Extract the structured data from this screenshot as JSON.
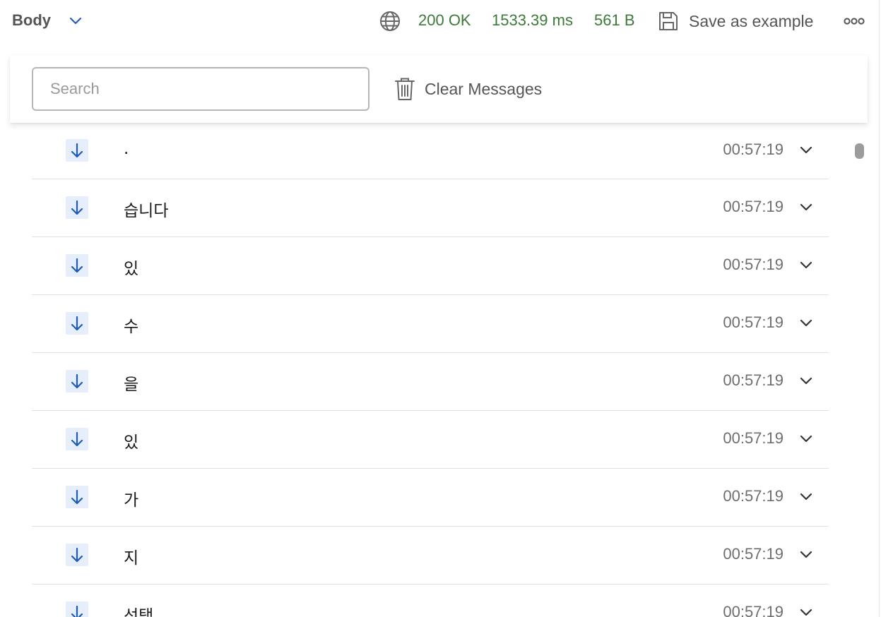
{
  "topbar": {
    "body_label": "Body",
    "status_code": "200 OK",
    "response_time": "1533.39 ms",
    "response_size": "561 B",
    "save_label": "Save as example",
    "icons": {
      "body_dropdown": "chevron-down-icon",
      "network": "globe-icon",
      "save": "save-icon",
      "more": "more-options-icon"
    }
  },
  "search": {
    "placeholder": "Search",
    "value": ""
  },
  "clear_messages": {
    "label": "Clear Messages",
    "icon": "trash-icon"
  },
  "colors": {
    "status_green": "#3d7a3a",
    "arrow_blue": "#1f5bb8",
    "arrow_bg": "#e6eefb",
    "text_gray": "#555555"
  },
  "messages": [
    {
      "direction": "received",
      "text": ".",
      "time": "00:57:19"
    },
    {
      "direction": "received",
      "text": "습니다",
      "time": "00:57:19"
    },
    {
      "direction": "received",
      "text": "있",
      "time": "00:57:19"
    },
    {
      "direction": "received",
      "text": "수",
      "time": "00:57:19"
    },
    {
      "direction": "received",
      "text": "을",
      "time": "00:57:19"
    },
    {
      "direction": "received",
      "text": "있",
      "time": "00:57:19"
    },
    {
      "direction": "received",
      "text": "가",
      "time": "00:57:19"
    },
    {
      "direction": "received",
      "text": "지",
      "time": "00:57:19"
    },
    {
      "direction": "received",
      "text": "선택",
      "time": "00:57:19"
    }
  ]
}
